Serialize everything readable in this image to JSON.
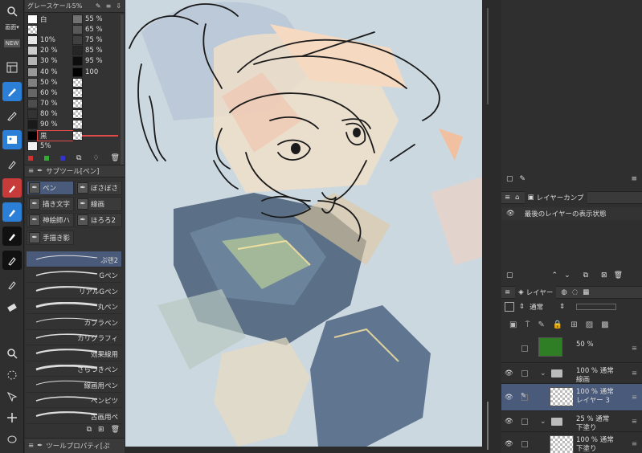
{
  "colorset": {
    "title": "グレースケール5%",
    "rows": [
      {
        "label": "白",
        "swatch": "#ffffff",
        "label2": "55 %",
        "swatch2": "#727272"
      },
      {
        "label": "",
        "swatch": "checker",
        "label2": "65 %",
        "swatch2": "#595959"
      },
      {
        "label": "10%",
        "swatch": "#e6e6e6",
        "label2": "75 %",
        "swatch2": "#404040"
      },
      {
        "label": "20 %",
        "swatch": "#cccccc",
        "label2": "85 %",
        "swatch2": "#262626"
      },
      {
        "label": "30 %",
        "swatch": "#b3b3b3",
        "label2": "95 %",
        "swatch2": "#0d0d0d"
      },
      {
        "label": "40 %",
        "swatch": "#999999",
        "label2": "100",
        "swatch2": "#000000"
      },
      {
        "label": "50 %",
        "swatch": "#808080",
        "label2": "",
        "swatch2": "checker"
      },
      {
        "label": "60 %",
        "swatch": "#666666",
        "label2": "",
        "swatch2": "checker"
      },
      {
        "label": "70 %",
        "swatch": "#4d4d4d",
        "label2": "",
        "swatch2": "checker"
      },
      {
        "label": "80 %",
        "swatch": "#333333",
        "label2": "",
        "swatch2": "checker"
      },
      {
        "label": "90 %",
        "swatch": "#1a1a1a",
        "label2": "",
        "swatch2": "checker"
      },
      {
        "label": "黒",
        "swatch": "#000000",
        "label2": "",
        "swatch2": "checker",
        "selected": true
      },
      {
        "label": "5%",
        "swatch": "#f2f2f2",
        "label2": "",
        "swatch2": ""
      }
    ]
  },
  "subtool": {
    "title": "サブツール[ペン]",
    "tabs": [
      {
        "label": "ペン",
        "active": true
      },
      {
        "label": "ぼさぼさ"
      },
      {
        "label": "描き文字"
      },
      {
        "label": "線画"
      },
      {
        "label": "神絵師ハ"
      },
      {
        "label": "ほろろ2"
      },
      {
        "label": "手描き影"
      }
    ],
    "brushes": [
      {
        "label": "ぷ랜2",
        "active": true
      },
      {
        "label": "Gペン"
      },
      {
        "label": "リアルGペン"
      },
      {
        "label": "丸ペン"
      },
      {
        "label": "カブラペン"
      },
      {
        "label": "カリグラフィ"
      },
      {
        "label": "効果線用"
      },
      {
        "label": "ざらつきペン"
      },
      {
        "label": "線画用ペン"
      },
      {
        "label": "ペンピツ"
      },
      {
        "label": "古画用ペ"
      }
    ]
  },
  "toolprop": {
    "title": "ツールプロパティ[ぷ"
  },
  "right": {
    "comp_tab": "レイヤーカンプ",
    "comp_item": "最後のレイヤーの表示状態",
    "layer_tab": "レイヤー",
    "blend_mode": "通常",
    "layers": [
      {
        "line1": "50 %",
        "line2": "",
        "thumb": "#2f7d25",
        "type": "fill"
      },
      {
        "line1": "100 % 通常",
        "line2": "線画",
        "type": "folder"
      },
      {
        "line1": "100 % 通常",
        "line2": "レイヤー 3",
        "type": "layer",
        "selected": true
      },
      {
        "line1": "25 % 通常",
        "line2": "下塗り",
        "type": "folder"
      },
      {
        "line1": "100 % 通常",
        "line2": "下塗り",
        "type": "layer"
      }
    ]
  },
  "colors": {
    "accent": "#2b7fd6",
    "selection": "#4a5a7a",
    "fill_green": "#2f7d25"
  }
}
